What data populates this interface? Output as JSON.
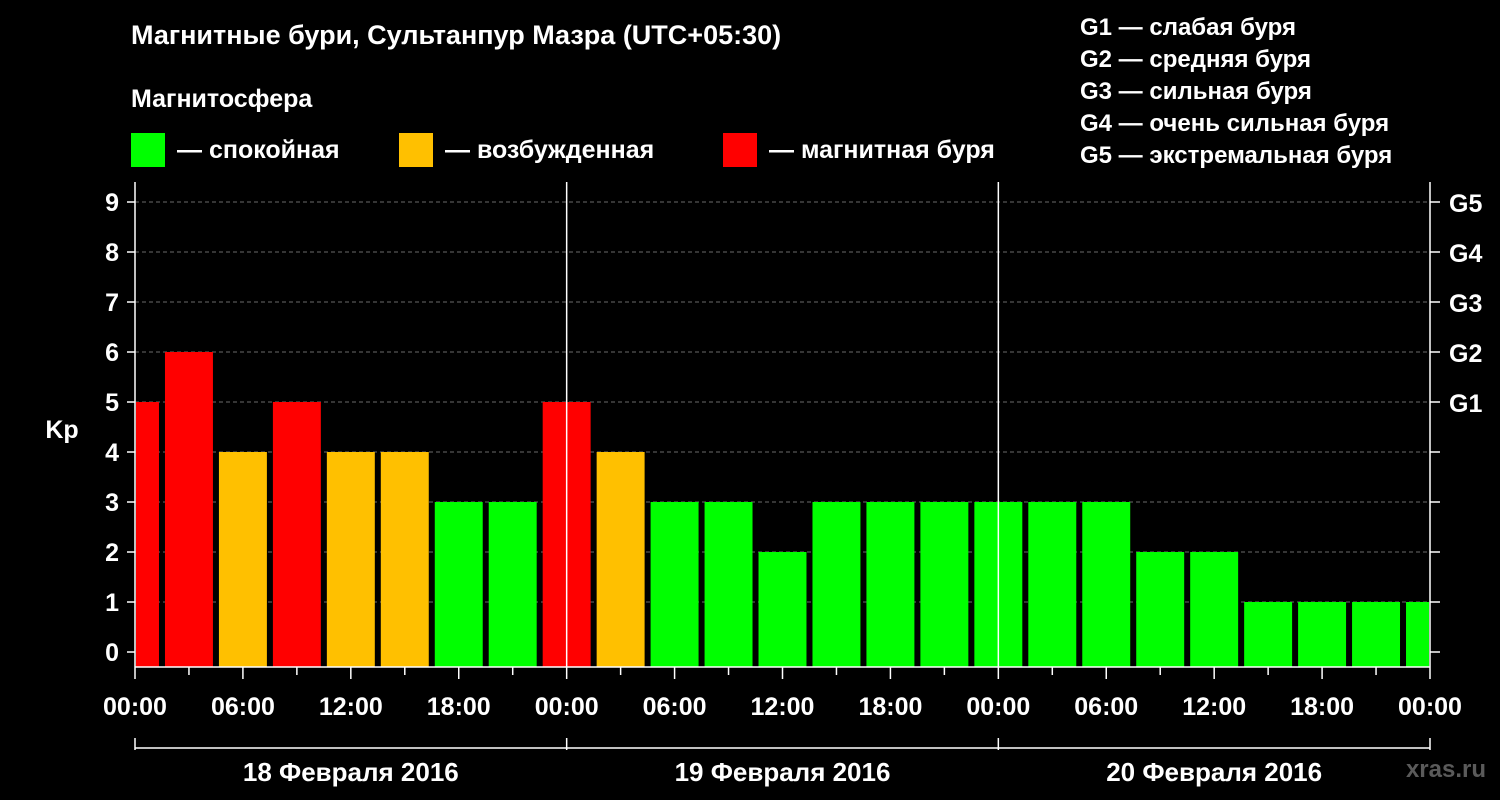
{
  "title": "Магнитные бури, Сультанпур Мазра (UTC+05:30)",
  "subtitle": "Магнитосфера",
  "legend": [
    {
      "label": "— спокойная",
      "color": "#00ff00"
    },
    {
      "label": "— возбужденная",
      "color": "#ffc000"
    },
    {
      "label": "— магнитная буря",
      "color": "#ff0000"
    }
  ],
  "g_legend": [
    "G1 — слабая буря",
    "G2 — средняя буря",
    "G3 — сильная буря",
    "G4 — очень сильная буря",
    "G5 — экстремальная буря"
  ],
  "brand": "xras.ru",
  "chart_data": {
    "type": "bar",
    "ylabel": "Kp",
    "ylim": [
      0,
      9
    ],
    "yticks": [
      0,
      1,
      2,
      3,
      4,
      5,
      6,
      7,
      8,
      9
    ],
    "right_ticks": [
      {
        "value": 5,
        "label": "G1"
      },
      {
        "value": 6,
        "label": "G2"
      },
      {
        "value": 7,
        "label": "G3"
      },
      {
        "value": 8,
        "label": "G4"
      },
      {
        "value": 9,
        "label": "G5"
      }
    ],
    "xticks": [
      "00:00",
      "06:00",
      "12:00",
      "18:00",
      "00:00",
      "06:00",
      "12:00",
      "18:00",
      "00:00",
      "06:00",
      "12:00",
      "18:00",
      "00:00"
    ],
    "days": [
      "18 Февраля 2016",
      "19 Февраля 2016",
      "20 Февраля 2016"
    ],
    "interval_hours": 3,
    "first_bar_start_hour": -1.5,
    "values": [
      5,
      6,
      4,
      5,
      4,
      4,
      3,
      3,
      5,
      4,
      3,
      3,
      2,
      3,
      3,
      3,
      3,
      3,
      3,
      2,
      2,
      1,
      1,
      1,
      1
    ],
    "colors": {
      "quiet": "#00ff00",
      "disturbed": "#ffc000",
      "storm": "#ff0000"
    },
    "grid": true
  }
}
